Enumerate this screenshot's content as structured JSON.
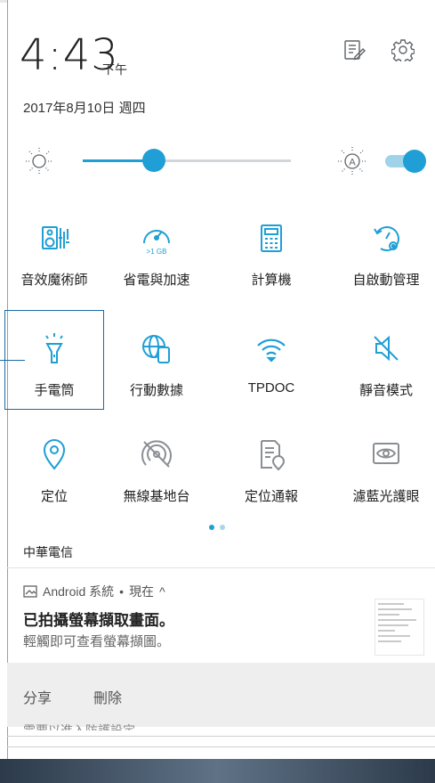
{
  "header": {
    "time": "4:43",
    "ampm": "下午",
    "date": "2017年8月10日 週四",
    "edit_icon": "edit-list-icon",
    "settings_icon": "gear-icon"
  },
  "brightness": {
    "level": 0.34,
    "auto_icon": "brightness-auto-icon",
    "auto_enabled": true
  },
  "colors": {
    "accent": "#1f9fd5",
    "accent_light": "#a9d6ea",
    "selection_outline": "#1b6aa5"
  },
  "tiles": [
    {
      "label": "音效魔術師",
      "icon": "audio-wizard-icon",
      "active": true
    },
    {
      "label": "省電與加速",
      "icon": "speedometer-boost-icon",
      "active": true
    },
    {
      "label": "計算機",
      "icon": "calculator-icon",
      "active": true
    },
    {
      "label": "自啟動管理",
      "icon": "auto-start-manager-icon",
      "active": true
    },
    {
      "label": "手電筒",
      "icon": "flashlight-icon",
      "active": true
    },
    {
      "label": "行動數據",
      "icon": "mobile-data-icon",
      "active": true
    },
    {
      "label": "TPDOC",
      "icon": "wifi-icon",
      "active": true
    },
    {
      "label": "靜音模式",
      "icon": "mute-icon",
      "active": true
    },
    {
      "label": "定位",
      "icon": "location-icon",
      "active": true
    },
    {
      "label": "無線基地台",
      "icon": "hotspot-off-icon",
      "active": false
    },
    {
      "label": "定位通報",
      "icon": "location-report-icon",
      "active": false
    },
    {
      "label": "濾藍光護眼",
      "icon": "eye-care-icon",
      "active": false
    }
  ],
  "carrier": "中華電信",
  "notification": {
    "app": "Android 系統",
    "separator": "•",
    "time": "現在",
    "expand_glyph": "^",
    "title": "已拍攝螢幕擷取畫面。",
    "body": "輕觸即可查看螢幕擷圖。",
    "actions": {
      "share": "分享",
      "delete": "刪除"
    }
  },
  "next_notification_partial": "需要以進入防護設定"
}
